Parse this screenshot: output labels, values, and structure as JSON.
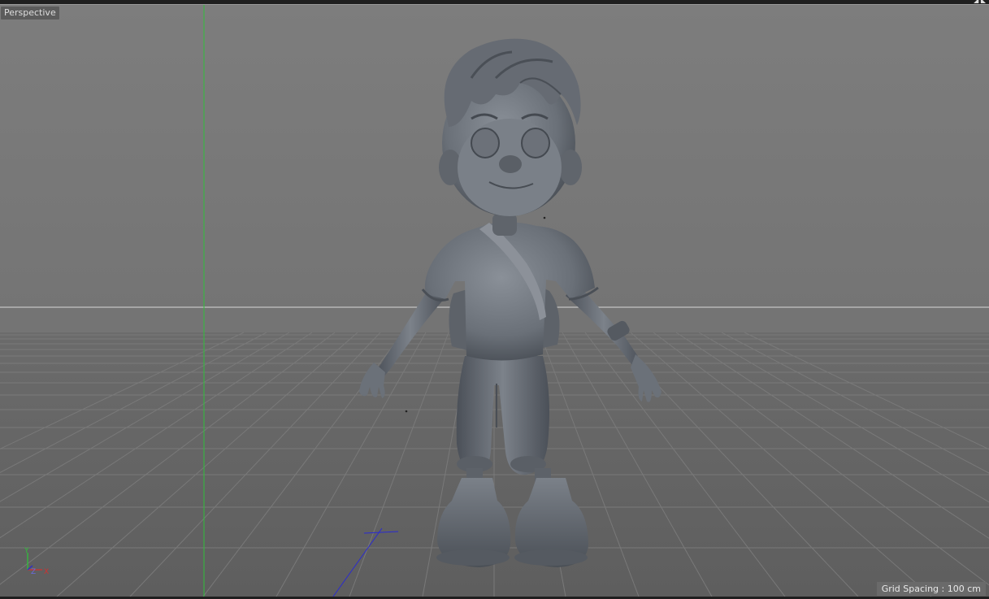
{
  "viewport": {
    "label": "Perspective",
    "grid_spacing_label": "Grid Spacing : 100 cm"
  },
  "axes": {
    "y": "Y",
    "z": "Z",
    "x": "X"
  },
  "icons": {
    "axis_gizmo": "axis-gizmo-icon",
    "view_controls": "viewport-nav-icons"
  },
  "colors": {
    "background": "#7a7a7a",
    "floor": "#666666",
    "horizon_line": "#d8d8d8",
    "y_axis_line": "#2fbf3a",
    "z_axis_line": "#2a2ad0",
    "model": "#6f747c",
    "label_bg": "#5c5c5c"
  }
}
